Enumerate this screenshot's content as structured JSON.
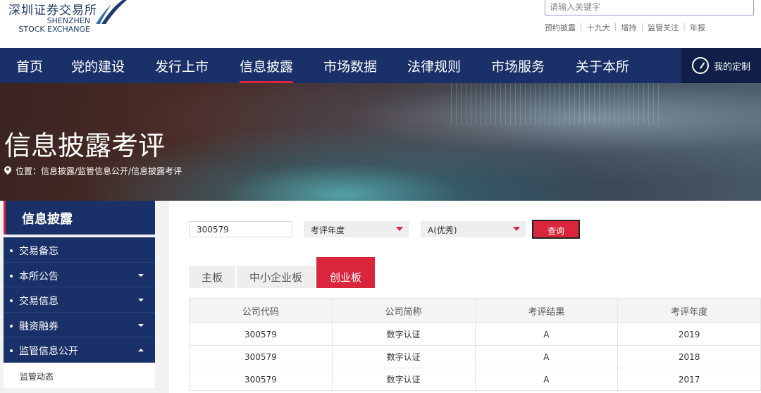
{
  "header": {
    "logo_cn": "深圳证券交易所",
    "logo_en_line1": "SHENZHEN",
    "logo_en_line2": "STOCK EXCHANGE",
    "search_placeholder": "请输入关键字",
    "quick_links": [
      "预约披露",
      "十九大",
      "增持",
      "监管关注",
      "年报"
    ]
  },
  "nav": {
    "items": [
      "首页",
      "党的建设",
      "发行上市",
      "信息披露",
      "市场数据",
      "法律规则",
      "市场服务",
      "关于本所"
    ],
    "active": "信息披露",
    "custom_label": "我的定制"
  },
  "banner": {
    "title": "信息披露考评",
    "breadcrumb": "位置：信息披露/监管信息公开/信息披露考评"
  },
  "sidebar": {
    "title": "信息披露",
    "items": [
      {
        "label": "交易备忘",
        "arrow": "none"
      },
      {
        "label": "本所公告",
        "arrow": "down"
      },
      {
        "label": "交易信息",
        "arrow": "down"
      },
      {
        "label": "融资融券",
        "arrow": "down"
      },
      {
        "label": "监管信息公开",
        "arrow": "up"
      }
    ],
    "sub_item": "监管动态"
  },
  "filters": {
    "code_value": "300579",
    "year_select": "考评年度",
    "result_select": "A(优秀)",
    "query_label": "查询"
  },
  "tabs": [
    "主板",
    "中小企业板",
    "创业板"
  ],
  "active_tab": "创业板",
  "table": {
    "headers": [
      "公司代码",
      "公司简称",
      "考评结果",
      "考评年度"
    ],
    "rows": [
      [
        "300579",
        "数字认证",
        "A",
        "2019"
      ],
      [
        "300579",
        "数字认证",
        "A",
        "2018"
      ],
      [
        "300579",
        "数字认证",
        "A",
        "2017"
      ]
    ]
  },
  "colors": {
    "nav_bg": "#1a3068",
    "accent_red": "#d9263c"
  }
}
